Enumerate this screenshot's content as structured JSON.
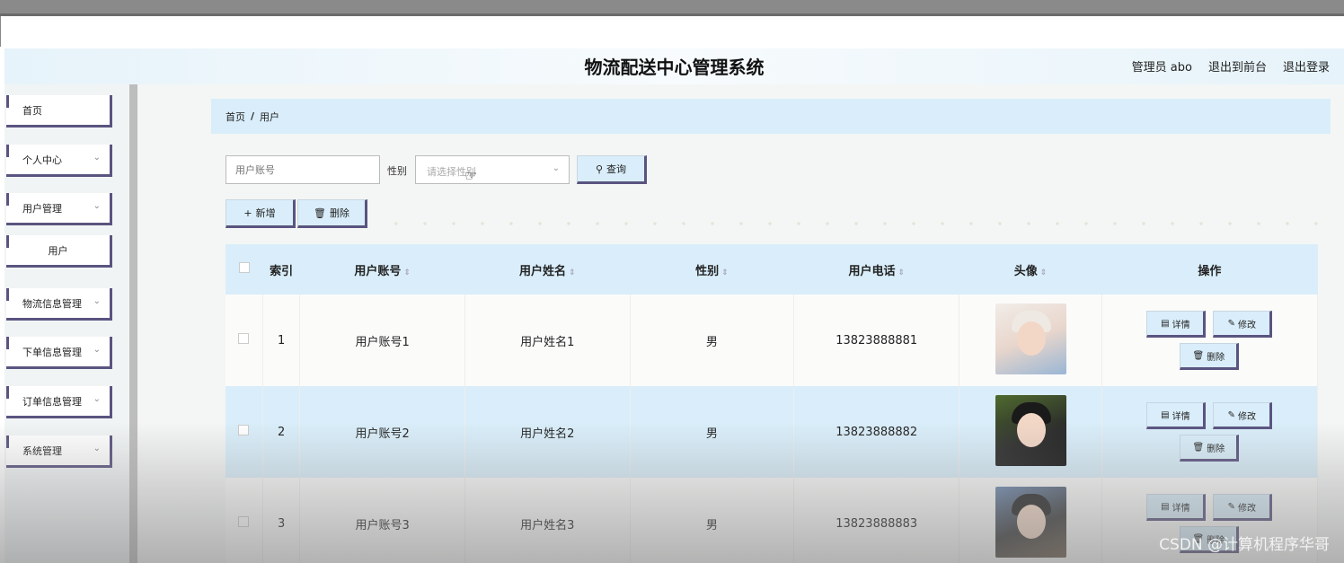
{
  "header": {
    "title": "物流配送中心管理系统",
    "admin": "管理员 abo",
    "front": "退出到前台",
    "logout": "退出登录"
  },
  "sidebar": {
    "items": [
      {
        "label": "首页"
      },
      {
        "label": "个人中心"
      },
      {
        "label": "用户管理"
      },
      {
        "label": "用户"
      },
      {
        "label": "物流信息管理"
      },
      {
        "label": "下单信息管理"
      },
      {
        "label": "订单信息管理"
      },
      {
        "label": "系统管理"
      }
    ]
  },
  "breadcrumb": {
    "home": "首页",
    "sep": "/",
    "current": "用户"
  },
  "search": {
    "account_placeholder": "用户账号",
    "gender_label": "性别",
    "gender_placeholder": "请选择性别",
    "query_label": "查询"
  },
  "toolbar": {
    "add_label": "新增",
    "delete_label": "删除"
  },
  "table": {
    "headers": {
      "index": "索引",
      "account": "用户账号",
      "name": "用户姓名",
      "gender": "性别",
      "phone": "用户电话",
      "avatar": "头像",
      "ops": "操作"
    },
    "rows": [
      {
        "index": "1",
        "account": "用户账号1",
        "name": "用户姓名1",
        "gender": "男",
        "phone": "13823888881"
      },
      {
        "index": "2",
        "account": "用户账号2",
        "name": "用户姓名2",
        "gender": "男",
        "phone": "13823888882"
      },
      {
        "index": "3",
        "account": "用户账号3",
        "name": "用户姓名3",
        "gender": "男",
        "phone": "13823888883"
      }
    ],
    "op_detail": "详情",
    "op_edit": "修改",
    "op_delete": "删除"
  },
  "watermark": "CSDN @计算机程序华哥",
  "icons": {
    "search": "search-icon",
    "plus": "plus-icon",
    "trash": "trash-icon",
    "doc": "doc-icon",
    "pencil": "pencil-icon",
    "chevron": "chevron-down-icon",
    "sort": "sort-icon"
  },
  "colors": {
    "accent": "#5a5480",
    "highlight": "#d9eefa"
  }
}
